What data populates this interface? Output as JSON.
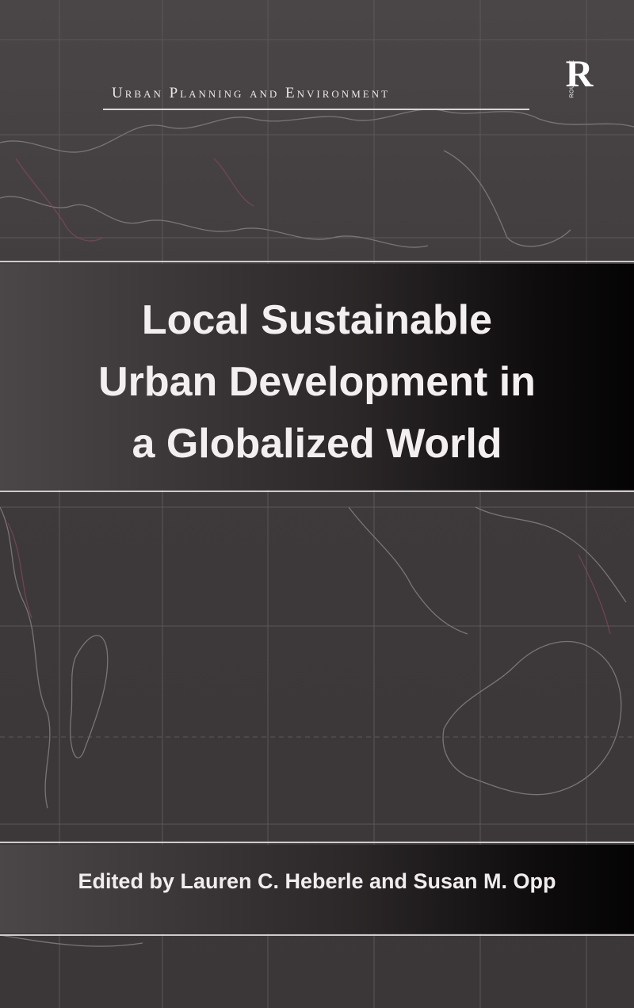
{
  "cover": {
    "series": "Urban Planning and Environment",
    "publisher_logo": {
      "letter": "R",
      "name": "ROUTLEDGE"
    },
    "title_lines": [
      "Local Sustainable",
      "Urban Development in",
      "a Globalized World"
    ],
    "editors": "Edited by Lauren C. Heberle and Susan M. Opp"
  },
  "colors": {
    "background": "#3f3b3d",
    "band_dark": "#050404",
    "text": "#f3eff0",
    "rule": "#cfcacc"
  },
  "icons": [
    "world-map-background",
    "routledge-logo"
  ]
}
